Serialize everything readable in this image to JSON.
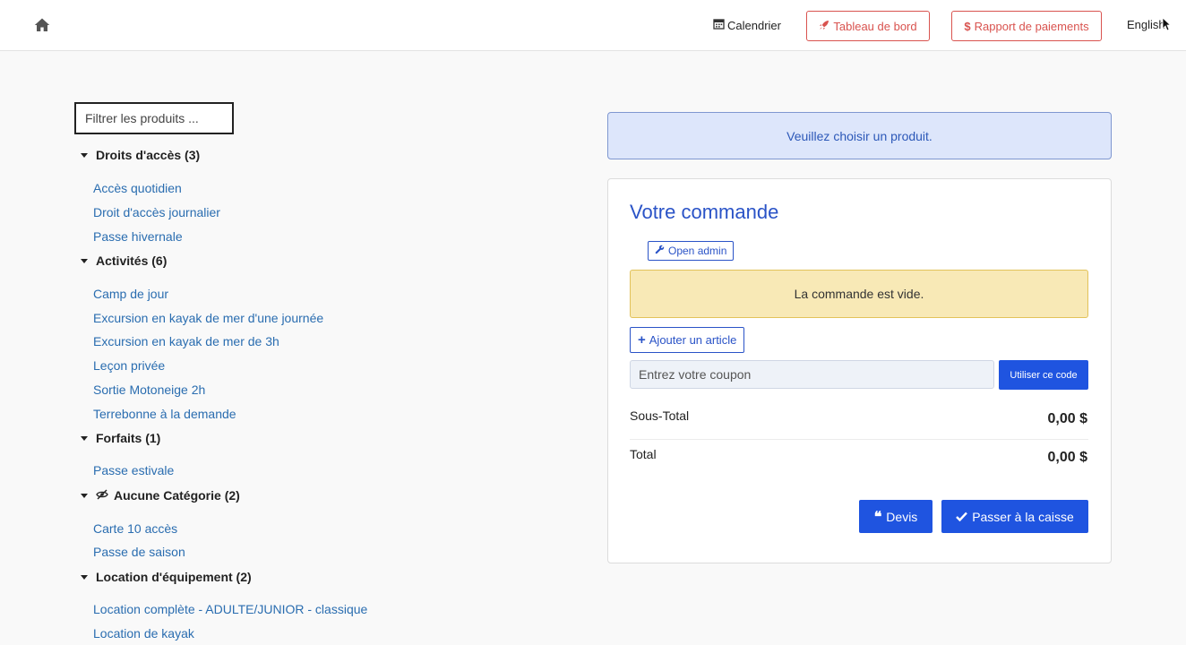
{
  "nav": {
    "home_icon": "home-icon",
    "calendar_label": "Calendrier",
    "dashboard_label": "Tableau de bord",
    "payments_label": "Rapport de paiements",
    "language_label": "English",
    "accent_color": "#d9534f"
  },
  "filter": {
    "placeholder": "Filtrer les produits ..."
  },
  "categories": [
    {
      "title": "Droits d'accès (3)",
      "items": [
        "Accès quotidien",
        "Droit d'accès journalier",
        "Passe hivernale"
      ]
    },
    {
      "title": "Activités (6)",
      "items": [
        "Camp de jour",
        "Excursion en kayak de mer d'une journée",
        "Excursion en kayak de mer de 3h",
        "Leçon privée",
        "Sortie Motoneige 2h",
        "Terrebonne à la demande"
      ]
    },
    {
      "title": "Forfaits (1)",
      "items": [
        "Passe estivale"
      ]
    },
    {
      "title": "Aucune Catégorie (2)",
      "icon": "eye-slash-icon",
      "items": [
        "Carte 10 accès",
        "Passe de saison"
      ]
    },
    {
      "title": "Location d'équipement (2)",
      "items": [
        "Location complète - ADULTE/JUNIOR - classique",
        "Location de kayak"
      ]
    }
  ],
  "info_alert": "Veuillez choisir un produit.",
  "order": {
    "title": "Votre commande",
    "admin_button": "Open admin",
    "empty_message": "La commande est vide.",
    "add_item_button": "Ajouter un article",
    "coupon_placeholder": "Entrez votre coupon",
    "coupon_button": "Utiliser ce code",
    "subtotal_label": "Sous-Total",
    "subtotal_value": "0,00 $",
    "total_label": "Total",
    "total_value": "0,00 $",
    "quote_button": "Devis",
    "checkout_button": "Passer à la caisse",
    "primary_color": "#1f54e0"
  }
}
